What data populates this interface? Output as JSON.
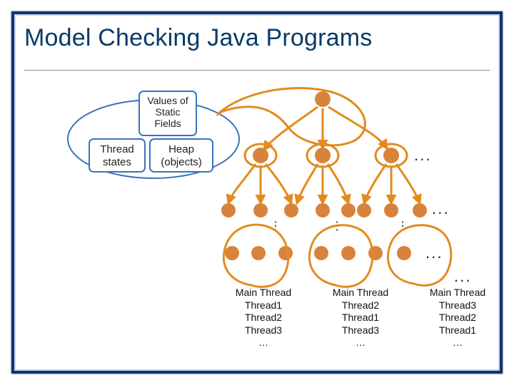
{
  "title": "Model Checking Java Programs",
  "legend": {
    "static_fields": {
      "line1": "Values of",
      "line2": "Static",
      "line3": "Fields"
    },
    "thread_states": {
      "line1": "Thread",
      "line2": "states"
    },
    "heap": {
      "line1": "Heap",
      "line2": "(objects)"
    }
  },
  "ellipses": {
    "row1": ". . .",
    "row2": ". . .",
    "row3": ". . .",
    "row4": ". . ."
  },
  "columns": [
    {
      "main": "Main Thread",
      "t1": "Thread1",
      "t2": "Thread2",
      "t3": "Thread3",
      "more": "…"
    },
    {
      "main": "Main Thread",
      "t1": "Thread2",
      "t2": "Thread1",
      "t3": "Thread3",
      "more": "…"
    },
    {
      "main": "Main Thread",
      "t1": "Thread3",
      "t2": "Thread2",
      "t3": "Thread1",
      "more": "…"
    }
  ],
  "colors": {
    "accent": "#0f356f",
    "orange": "#e38b1e",
    "node": "#d8833b"
  }
}
